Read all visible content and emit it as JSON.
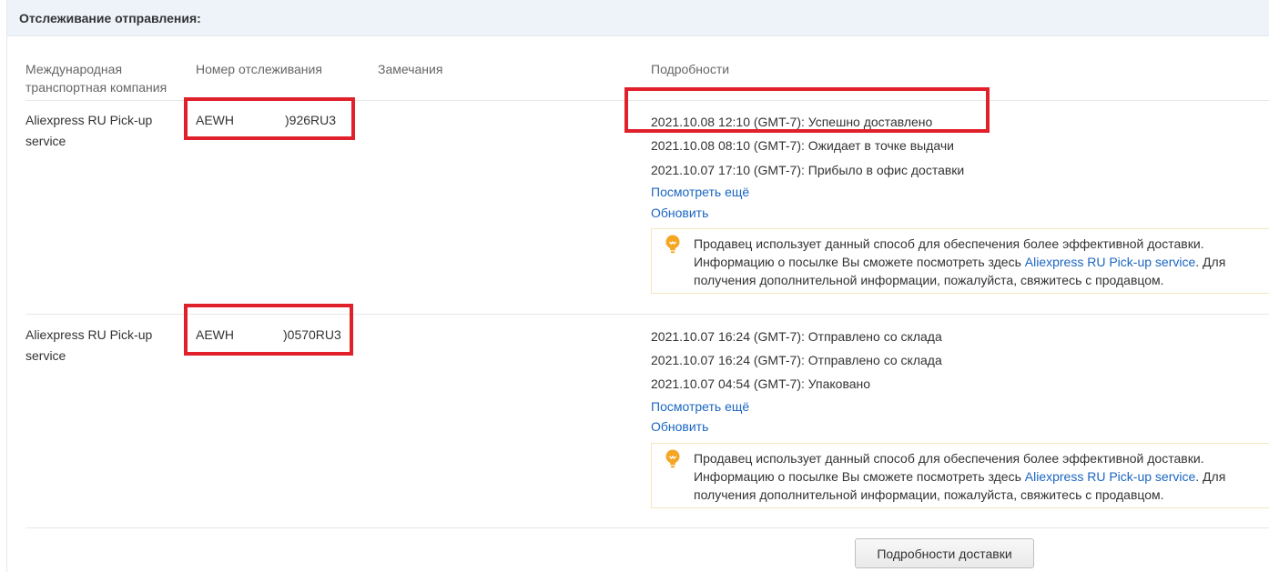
{
  "panel": {
    "title": "Отслеживание отправления:"
  },
  "columns": {
    "carrier": "Международная транспортная компания",
    "tracking": "Номер отслеживания",
    "notes": "Замечания",
    "details": "Подробности"
  },
  "shipments": [
    {
      "carrier": "Aliexpress RU Pick-up service",
      "tracking_prefix": "AEWH",
      "tracking_suffix": ")926RU3",
      "events": [
        "2021.10.08 12:10 (GMT-7): Успешно доставлено",
        "2021.10.08 08:10 (GMT-7): Ожидает в точке выдачи",
        "2021.10.07 17:10 (GMT-7): Прибыло в офис доставки"
      ],
      "more_label": "Посмотреть ещё",
      "refresh_label": "Обновить",
      "notice": {
        "before": "Продавец использует данный способ для обеспечения более эффективной доставки. Информацию о посылке Вы сможете посмотреть здесь ",
        "link": "Aliexpress RU Pick-up service",
        "after": ". Для получения дополнительной информации, пожалуйста, свяжитесь с продавцом."
      }
    },
    {
      "carrier": "Aliexpress RU Pick-up service",
      "tracking_prefix": "AEWH",
      "tracking_suffix": ")0570RU3",
      "events": [
        "2021.10.07 16:24 (GMT-7): Отправлено со склада",
        "2021.10.07 16:24 (GMT-7): Отправлено со склада",
        "2021.10.07 04:54 (GMT-7): Упаковано"
      ],
      "more_label": "Посмотреть ещё",
      "refresh_label": "Обновить",
      "notice": {
        "before": "Продавец использует данный способ для обеспечения более эффективной доставки. Информацию о посылке Вы сможете посмотреть здесь ",
        "link": "Aliexpress RU Pick-up service",
        "after": ". Для получения дополнительной информации, пожалуйста, свяжитесь с продавцом."
      }
    }
  ],
  "footer": {
    "delivery_details_button": "Подробности доставки"
  },
  "colors": {
    "highlight": "#e0202a",
    "link": "#1a66c2",
    "header_bg": "#eef3fa",
    "icon": "#f5a623"
  },
  "icons": {
    "notice": "lightbulb-icon"
  }
}
